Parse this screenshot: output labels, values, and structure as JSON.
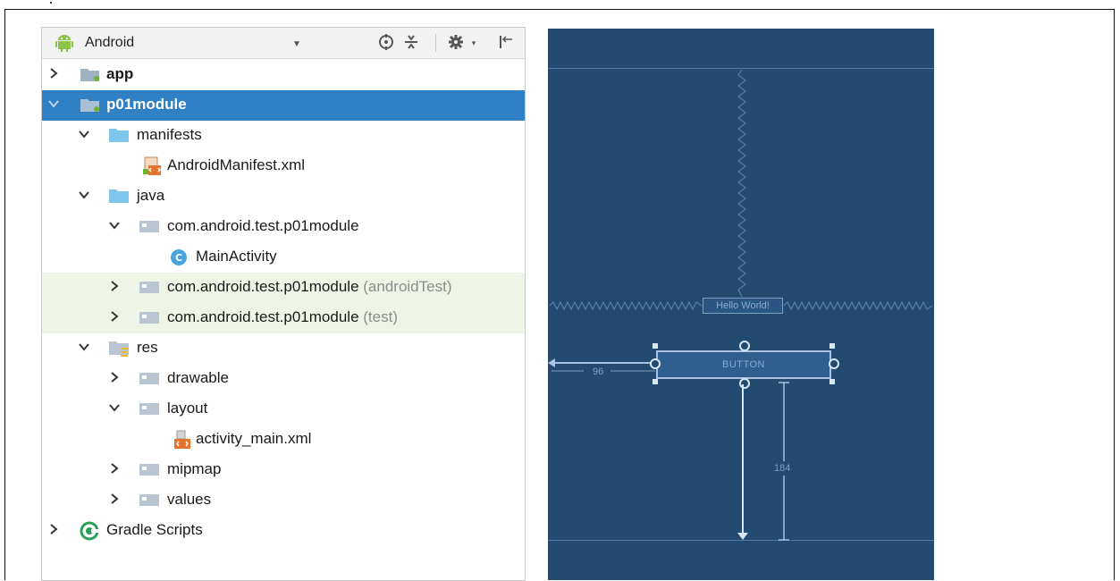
{
  "project_panel": {
    "view_label": "Android",
    "tree": [
      {
        "label": "app",
        "suffix": "",
        "arrow": "right"
      },
      {
        "label": "p01module",
        "suffix": "",
        "arrow": "down"
      },
      {
        "label": "manifests",
        "suffix": "",
        "arrow": "down"
      },
      {
        "label": "AndroidManifest.xml",
        "suffix": "",
        "arrow": ""
      },
      {
        "label": "java",
        "suffix": "",
        "arrow": "down"
      },
      {
        "label": "com.android.test.p01module",
        "suffix": "",
        "arrow": "down"
      },
      {
        "label": "MainActivity",
        "suffix": "",
        "arrow": ""
      },
      {
        "label": "com.android.test.p01module",
        "suffix": "(androidTest)",
        "arrow": "right"
      },
      {
        "label": "com.android.test.p01module",
        "suffix": "(test)",
        "arrow": "right"
      },
      {
        "label": "res",
        "suffix": "",
        "arrow": "down"
      },
      {
        "label": "drawable",
        "suffix": "",
        "arrow": "right"
      },
      {
        "label": "layout",
        "suffix": "",
        "arrow": "down"
      },
      {
        "label": "activity_main.xml",
        "suffix": "",
        "arrow": ""
      },
      {
        "label": "mipmap",
        "suffix": "",
        "arrow": "right"
      },
      {
        "label": "values",
        "suffix": "",
        "arrow": "right"
      },
      {
        "label": "Gradle Scripts",
        "suffix": "",
        "arrow": "right"
      }
    ],
    "selected_item": "p01module",
    "icons": {
      "toolbar": [
        "android-icon",
        "locate-icon",
        "collapse-all-icon",
        "gear-icon",
        "hide-icon"
      ],
      "module": "module-folder-icon",
      "folder": "folder-icon",
      "manifest": "xml-manifest-icon",
      "class": "java-class-icon",
      "layout_file": "layout-xml-icon",
      "gradle": "gradle-icon"
    }
  },
  "blueprint": {
    "textview_text": "Hello World!",
    "button_text": "BUTTON",
    "margin_start": "96",
    "margin_bottom": "184"
  },
  "colors": {
    "selection": "#2f80c4",
    "test_source_bg": "#eef5e6",
    "blueprint_bg": "#234a70",
    "blueprint_line": "#4f7bab"
  }
}
